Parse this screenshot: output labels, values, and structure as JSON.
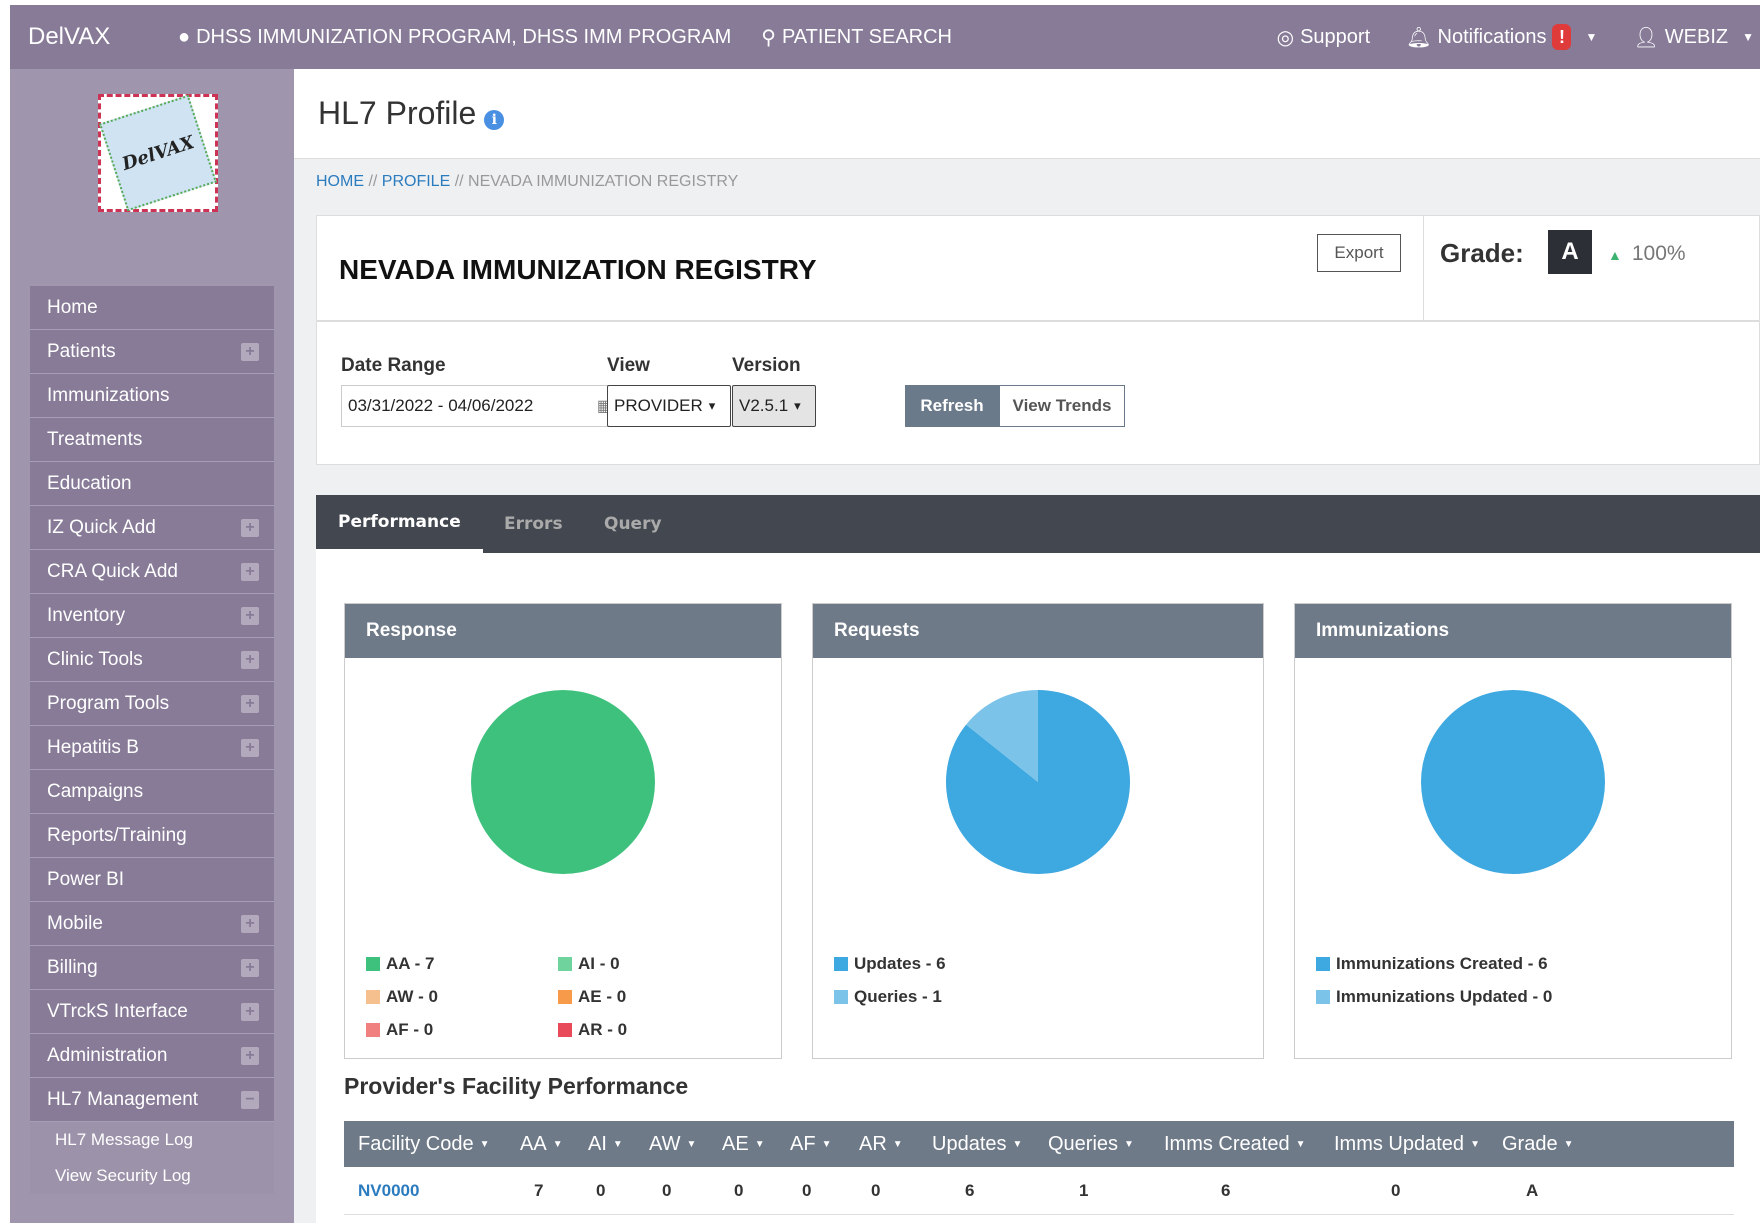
{
  "topnav": {
    "brand": "DelVAX",
    "program": "DHSS IMMUNIZATION PROGRAM, DHSS IMM PROGRAM",
    "patient_search": "PATIENT SEARCH",
    "support": "Support",
    "notifications": "Notifications",
    "notifications_badge": "!",
    "user": "WEBIZ"
  },
  "sidebar": {
    "logo_text": "DelVAX",
    "items": [
      {
        "label": "Home",
        "expand": ""
      },
      {
        "label": "Patients",
        "expand": "+"
      },
      {
        "label": "Immunizations",
        "expand": ""
      },
      {
        "label": "Treatments",
        "expand": ""
      },
      {
        "label": "Education",
        "expand": ""
      },
      {
        "label": "IZ Quick Add",
        "expand": "+"
      },
      {
        "label": "CRA Quick Add",
        "expand": "+"
      },
      {
        "label": "Inventory",
        "expand": "+"
      },
      {
        "label": "Clinic Tools",
        "expand": "+"
      },
      {
        "label": "Program Tools",
        "expand": "+"
      },
      {
        "label": "Hepatitis B",
        "expand": "+"
      },
      {
        "label": "Campaigns",
        "expand": ""
      },
      {
        "label": "Reports/Training",
        "expand": ""
      },
      {
        "label": "Power BI",
        "expand": ""
      },
      {
        "label": "Mobile",
        "expand": "+"
      },
      {
        "label": "Billing",
        "expand": "+"
      },
      {
        "label": "VTrckS Interface",
        "expand": "+"
      },
      {
        "label": "Administration",
        "expand": "+"
      },
      {
        "label": "HL7 Management",
        "expand": "−"
      }
    ],
    "subitems": [
      "HL7 Message Log",
      "View Security Log"
    ]
  },
  "page": {
    "title": "HL7 Profile",
    "info": "i",
    "breadcrumb": {
      "home": "HOME",
      "sep": " // ",
      "profile": "PROFILE",
      "current": "NEVADA IMMUNIZATION REGISTRY"
    }
  },
  "registry": {
    "name": "NEVADA IMMUNIZATION REGISTRY",
    "export_label": "Export",
    "grade_label": "Grade:",
    "grade": "A",
    "grade_percent": "100%"
  },
  "filters": {
    "date_range_label": "Date Range",
    "date_range_value": "03/31/2022 - 04/06/2022",
    "view_label": "View",
    "view_value": "PROVIDER",
    "version_label": "Version",
    "version_value": "V2.5.1",
    "refresh_label": "Refresh",
    "trends_label": "View Trends"
  },
  "tabs": [
    "Performance",
    "Errors",
    "Query"
  ],
  "colors": {
    "AA": "#3dc17d",
    "AI": "#6fd39e",
    "AW": "#f5c08e",
    "AE": "#f79a4a",
    "AF": "#f08080",
    "AR": "#e84a5a",
    "updates": "#3ea8e0",
    "queries": "#7cc3ea",
    "created": "#3ea8e0",
    "updated": "#7cc3ea"
  },
  "chart_data": [
    {
      "type": "pie",
      "title": "Response",
      "categories": [
        "AA",
        "AI",
        "AW",
        "AE",
        "AF",
        "AR"
      ],
      "values": [
        7,
        0,
        0,
        0,
        0,
        0
      ],
      "legend_labels": [
        "AA - 7",
        "AI - 0",
        "AW - 0",
        "AE - 0",
        "AF - 0",
        "AR - 0"
      ]
    },
    {
      "type": "pie",
      "title": "Requests",
      "categories": [
        "Updates",
        "Queries"
      ],
      "values": [
        6,
        1
      ],
      "legend_labels": [
        "Updates - 6",
        "Queries - 1"
      ]
    },
    {
      "type": "pie",
      "title": "Immunizations",
      "categories": [
        "Immunizations Created",
        "Immunizations Updated"
      ],
      "values": [
        6,
        0
      ],
      "legend_labels": [
        "Immunizations Created - 6",
        "Immunizations Updated - 0"
      ]
    }
  ],
  "facility": {
    "title": "Provider's Facility Performance",
    "headers": [
      "Facility Code",
      "AA",
      "AI",
      "AW",
      "AE",
      "AF",
      "AR",
      "Updates",
      "Queries",
      "Imms Created",
      "Imms Updated",
      "Grade"
    ],
    "rows": [
      [
        "NV0000",
        "7",
        "0",
        "0",
        "0",
        "0",
        "0",
        "6",
        "1",
        "6",
        "0",
        "A"
      ]
    ]
  }
}
